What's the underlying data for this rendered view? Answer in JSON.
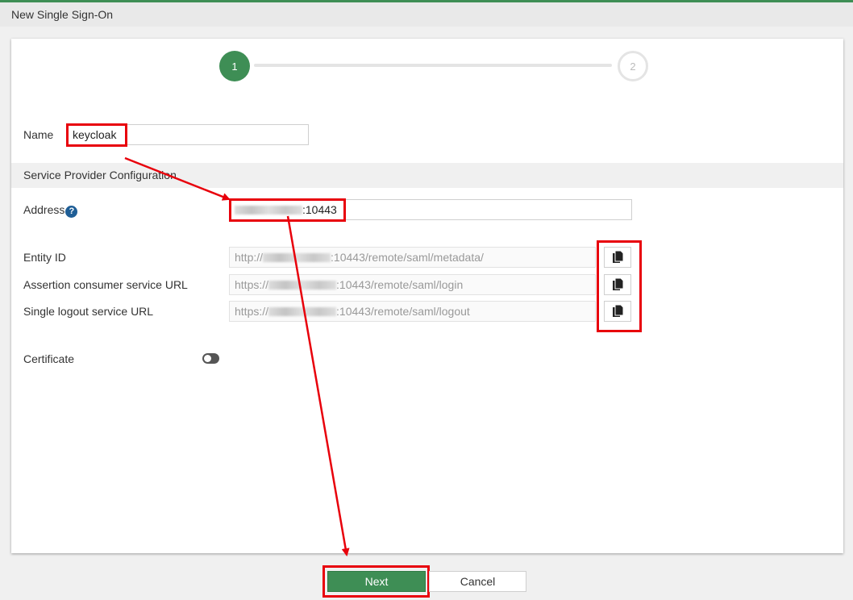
{
  "window": {
    "title": "New Single Sign-On"
  },
  "stepper": {
    "step1": "1",
    "step2": "2"
  },
  "form": {
    "name_label": "Name",
    "name_value": "keycloak",
    "section_title": "Service Provider Configuration",
    "address_label": "Address",
    "address_help": "?",
    "address_value_suffix": ":10443",
    "entity_id_label": "Entity ID",
    "entity_id_prefix": "http://",
    "entity_id_suffix": ":10443/remote/saml/metadata/",
    "acs_label": "Assertion consumer service URL",
    "acs_prefix": "https://",
    "acs_suffix": ":10443/remote/saml/login",
    "slo_label": "Single logout service URL",
    "slo_prefix": "https://",
    "slo_suffix": ":10443/remote/saml/logout",
    "certificate_label": "Certificate",
    "certificate_enabled": false
  },
  "footer": {
    "next_label": "Next",
    "cancel_label": "Cancel"
  },
  "colors": {
    "accent": "#3e8e55",
    "highlight": "#e8000b",
    "help": "#1f5e96"
  },
  "icons": {
    "copy": "copy-icon",
    "help": "help-circle-icon"
  }
}
